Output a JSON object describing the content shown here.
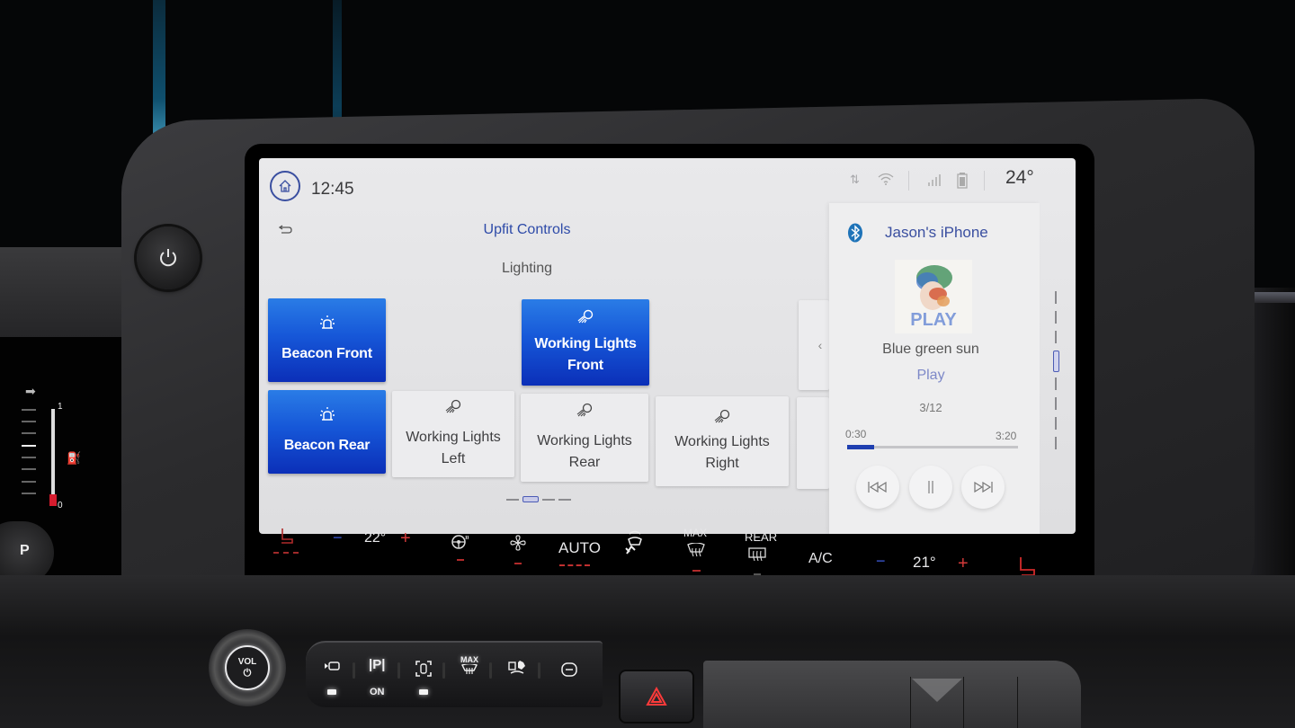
{
  "status_bar": {
    "time": "12:45",
    "outside_temp": "24°",
    "icons": [
      "home-icon",
      "data-transfer-icon",
      "wifi-icon",
      "signal-icon",
      "battery-icon"
    ]
  },
  "upfit": {
    "back_icon": "back-arrow-icon",
    "title": "Upfit Controls",
    "section": "Lighting",
    "tiles": [
      {
        "label": "Beacon Front",
        "icon": "beacon-icon",
        "active": true
      },
      {
        "label": "Working Lights Front",
        "icon": "work-light-icon",
        "active": true
      },
      {
        "label": "Beacon Rear",
        "icon": "beacon-icon",
        "active": true
      },
      {
        "label": "Working Lights Left",
        "icon": "work-light-icon",
        "active": false
      },
      {
        "label": "Working Lights Rear",
        "icon": "work-light-icon",
        "active": false
      },
      {
        "label": "Working Lights Right",
        "icon": "work-light-icon",
        "active": false
      }
    ],
    "collapse_icon": "chevron-left-icon",
    "pager": {
      "pages": 4,
      "current": 2
    }
  },
  "media": {
    "source_icon": "bluetooth-icon",
    "device": "Jason's iPhone",
    "album_art_text": "PLAY",
    "track": "Blue green sun",
    "artist": "Play",
    "track_position": "3/12",
    "elapsed": "0:30",
    "total": "3:20",
    "progress_fraction": 0.156,
    "controls": [
      "previous-track-icon",
      "pause-icon",
      "next-track-icon"
    ]
  },
  "climate": {
    "driver_temp": "22°",
    "passenger_temp": "21°",
    "minus": "−",
    "plus": "+",
    "auto_label": "AUTO",
    "max_label": "MAX",
    "rear_label": "REAR",
    "ac_label": "A/C"
  },
  "console": {
    "vol_label": "VOL",
    "power_glyph": "⏻",
    "on_label": "ON",
    "max_label": "MAX",
    "park_label": "|P|"
  },
  "cluster": {
    "gauge_top": "1",
    "gauge_bottom": "0",
    "gear": "P"
  },
  "colors": {
    "accent_blue": "#1657d8",
    "title_blue": "#2d4aa8",
    "climate_red": "#d43a3a",
    "climate_blue": "#3d5ad8",
    "screen_bg": "#e4e4e6"
  }
}
